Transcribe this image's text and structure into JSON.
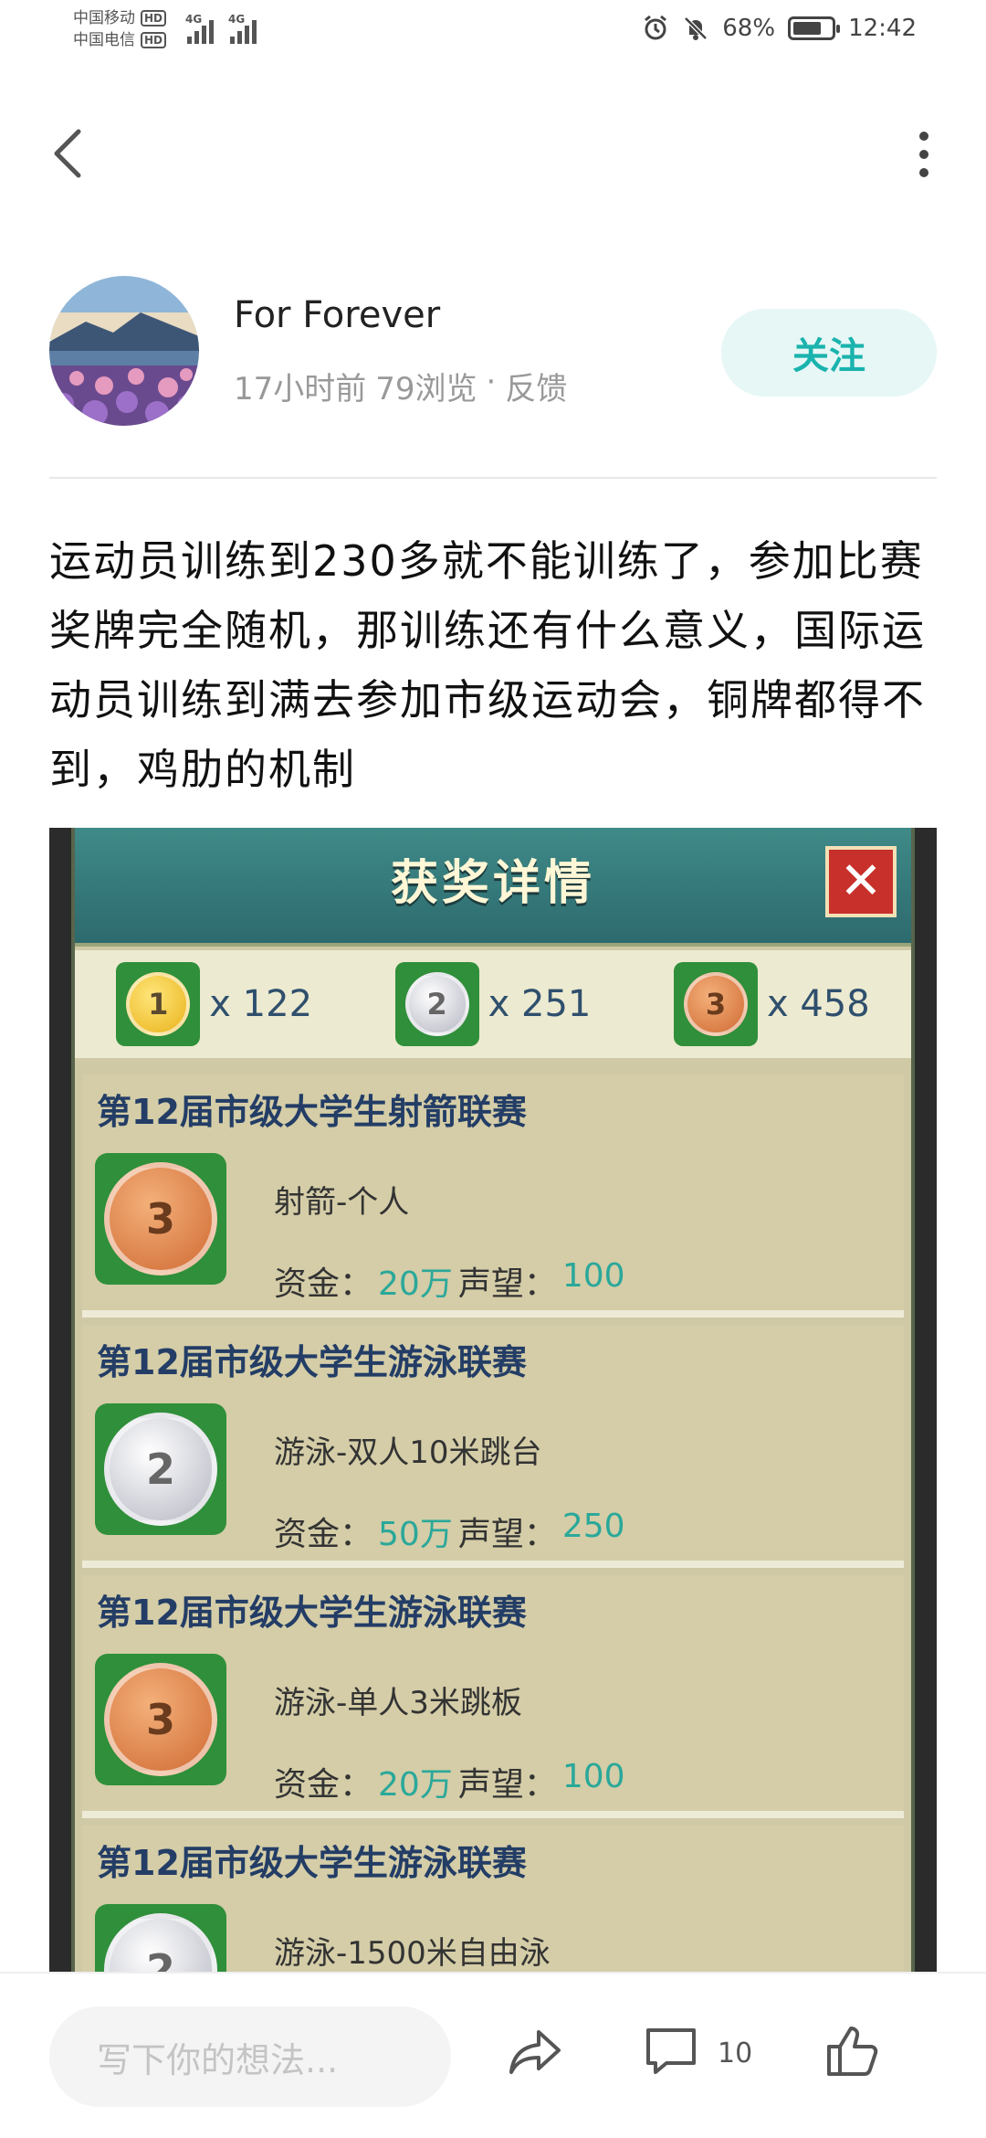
{
  "status_bar": {
    "carrier1": "中国移动",
    "carrier2": "中国电信",
    "hd": "HD",
    "net": "4G",
    "battery": "68%",
    "time": "12:42",
    "battery_level": 0.68
  },
  "nav": {
    "back_icon": "back-chevron-icon",
    "more_icon": "more-vertical-icon"
  },
  "author": {
    "name": "For Forever",
    "time_ago": "17小时前",
    "views": "79浏览",
    "separator": "·",
    "feedback": "反馈",
    "follow_label": "关注"
  },
  "post": {
    "text": "运动员训练到230多就不能训练了，参加比赛奖牌完全随机，那训练还有什么意义，国际运动员训练到满去参加市级运动会，铜牌都得不到，鸡肋的机制"
  },
  "game": {
    "title": "获奖详情",
    "close": "✕",
    "counts": [
      {
        "rank": "1",
        "label": "x 122",
        "type": "gold"
      },
      {
        "rank": "2",
        "label": "x 251",
        "type": "silver"
      },
      {
        "rank": "3",
        "label": "x 458",
        "type": "bronze"
      }
    ],
    "events": [
      {
        "title": "第12届市级大学生射箭联赛",
        "medal": "3",
        "type": "bronze",
        "name": "射箭-个人",
        "fund_label": "资金：",
        "fund": "20万",
        "rep_label": "声望：",
        "rep": "100"
      },
      {
        "title": "第12届市级大学生游泳联赛",
        "medal": "2",
        "type": "silver",
        "name": "游泳-双人10米跳台",
        "fund_label": "资金：",
        "fund": "50万",
        "rep_label": "声望：",
        "rep": "250"
      },
      {
        "title": "第12届市级大学生游泳联赛",
        "medal": "3",
        "type": "bronze",
        "name": "游泳-单人3米跳板",
        "fund_label": "资金：",
        "fund": "20万",
        "rep_label": "声望：",
        "rep": "100"
      },
      {
        "title": "第12届市级大学生游泳联赛",
        "medal": "2",
        "type": "silver",
        "name": "游泳-1500米自由泳",
        "fund_label": "",
        "fund": "",
        "rep_label": "",
        "rep": ""
      }
    ]
  },
  "bottom": {
    "placeholder": "写下你的想法...",
    "comment_count": "10",
    "share_icon": "share-icon",
    "comment_icon": "comment-icon",
    "like_icon": "thumbs-up-icon"
  }
}
